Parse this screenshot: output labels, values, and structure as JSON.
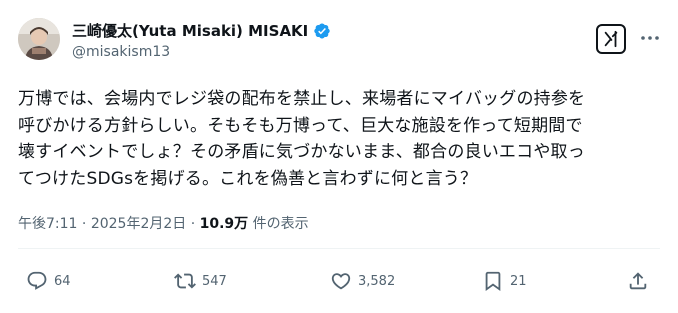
{
  "author": {
    "display_name": "三崎優太(Yuta Misaki) MISAKI",
    "handle": "@misakism13",
    "verified_color": "#1d9bf0"
  },
  "header_icons": {
    "grok": "grok-icon",
    "more": "more-options-icon"
  },
  "post": {
    "text": "万博では、会場内でレジ袋の配布を禁止し、来場者にマイバッグの持参を\n呼びかける方針らしい。そもそも万博って、巨大な施設を作って短期間で\n壊すイベントでしょ？その矛盾に気づかないまま、都合の良いエコや取っ\nてつけたSDGsを掲げる。これを偽善と言わずに何と言う？"
  },
  "meta": {
    "time": "午後7:11",
    "separator": "·",
    "date": "2025年2月2日",
    "views_count": "10.9万",
    "views_label": "件の表示"
  },
  "actions": {
    "replies": "64",
    "reposts": "547",
    "likes": "3,582",
    "bookmarks": "21"
  },
  "colors": {
    "text_primary": "#0f1419",
    "text_secondary": "#536471",
    "accent": "#1d9bf0",
    "divider": "#eff3f4"
  }
}
